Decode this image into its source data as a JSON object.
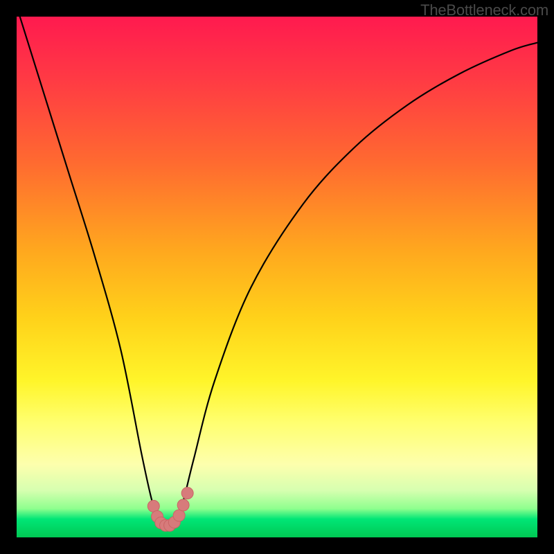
{
  "watermark": "TheBottleneck.com",
  "chart_data": {
    "type": "line",
    "title": "",
    "xlabel": "",
    "ylabel": "",
    "xlim": [
      0,
      100
    ],
    "ylim": [
      0,
      100
    ],
    "series": [
      {
        "name": "bottleneck-curve",
        "x": [
          0,
          5,
          10,
          15,
          20,
          24,
          26,
          27.5,
          29,
          30.5,
          32,
          34,
          38,
          45,
          55,
          65,
          75,
          85,
          95,
          100
        ],
        "values": [
          102,
          86,
          70,
          54,
          36,
          16,
          7,
          3,
          2,
          3,
          7,
          15,
          30,
          48,
          64,
          75,
          83,
          89,
          93.5,
          95
        ]
      },
      {
        "name": "highlight-dots",
        "x": [
          26.3,
          27.0,
          27.7,
          28.6,
          29.4,
          30.3,
          31.2,
          32.0,
          32.8
        ],
        "values": [
          6.0,
          4.0,
          2.8,
          2.3,
          2.3,
          2.9,
          4.2,
          6.2,
          8.5
        ]
      }
    ],
    "colors": {
      "curve": "#000000",
      "dots": "#d77b7b",
      "dots_stroke": "#c96565"
    }
  }
}
